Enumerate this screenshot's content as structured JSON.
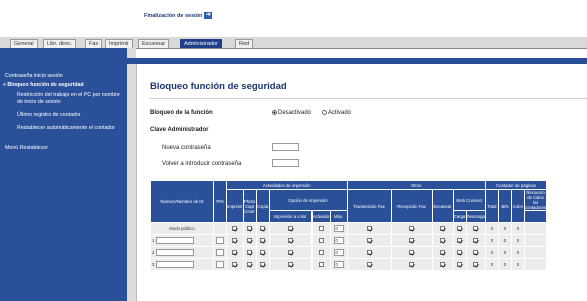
{
  "header": {
    "logout_label": "Finalización de sesión"
  },
  "tabs": [
    "General",
    "Libr. direc.",
    "Fax",
    "Imprimir",
    "Escanear",
    "Administrador",
    "Red"
  ],
  "sidebar": {
    "items": [
      {
        "label": "Contraseña inicio sesión"
      },
      {
        "label": "» Bloqueo función de seguridad"
      },
      {
        "label": "Restricción del trabajo en el PC por nombre de inicio de sesión"
      },
      {
        "label": "Último registro de contador"
      },
      {
        "label": "Restablecer automáticamente el contador"
      },
      {
        "label": "Menú Restablecer"
      }
    ]
  },
  "main": {
    "title": "Bloqueo función de seguridad",
    "lock_label": "Bloqueo de la función",
    "option_off": "Desactivado",
    "option_on": "Activado",
    "admin_label": "Clave Administrador",
    "new_pw_label": "Nueva contraseña",
    "confirm_pw_label": "Volver a introducir contraseña"
  },
  "table": {
    "col_id": "Número/Nombre de ID",
    "col_pin": "PIN",
    "grp_print": "Actividades de impresión",
    "grp_other": "Otros",
    "grp_counter": "Contador de páginas",
    "h_imprimir": "Imprimir",
    "h_photo": "Photo Capt Centr",
    "h_copia": "Copia",
    "h_opcion": "Opción de impresión",
    "h_color_print": "Impresión a color",
    "h_limite": "Límite de página",
    "h_activado": "Activado",
    "h_max": "Máx.",
    "h_tx_fax": "Transmisión Fax",
    "h_rx_fax": "Recepción Fax",
    "h_scan": "Escanear",
    "h_web": "Web Connect",
    "h_carga": "Carga",
    "h_descarga": "Descarga",
    "h_total": "Total",
    "h_bn": "B/N",
    "h_color": "Color",
    "h_reset": "Recuento de todos los contadores",
    "public_mode": "Modo público",
    "rows": [
      "1",
      "2",
      "3"
    ],
    "max_value": "0",
    "counter_value": "0"
  }
}
